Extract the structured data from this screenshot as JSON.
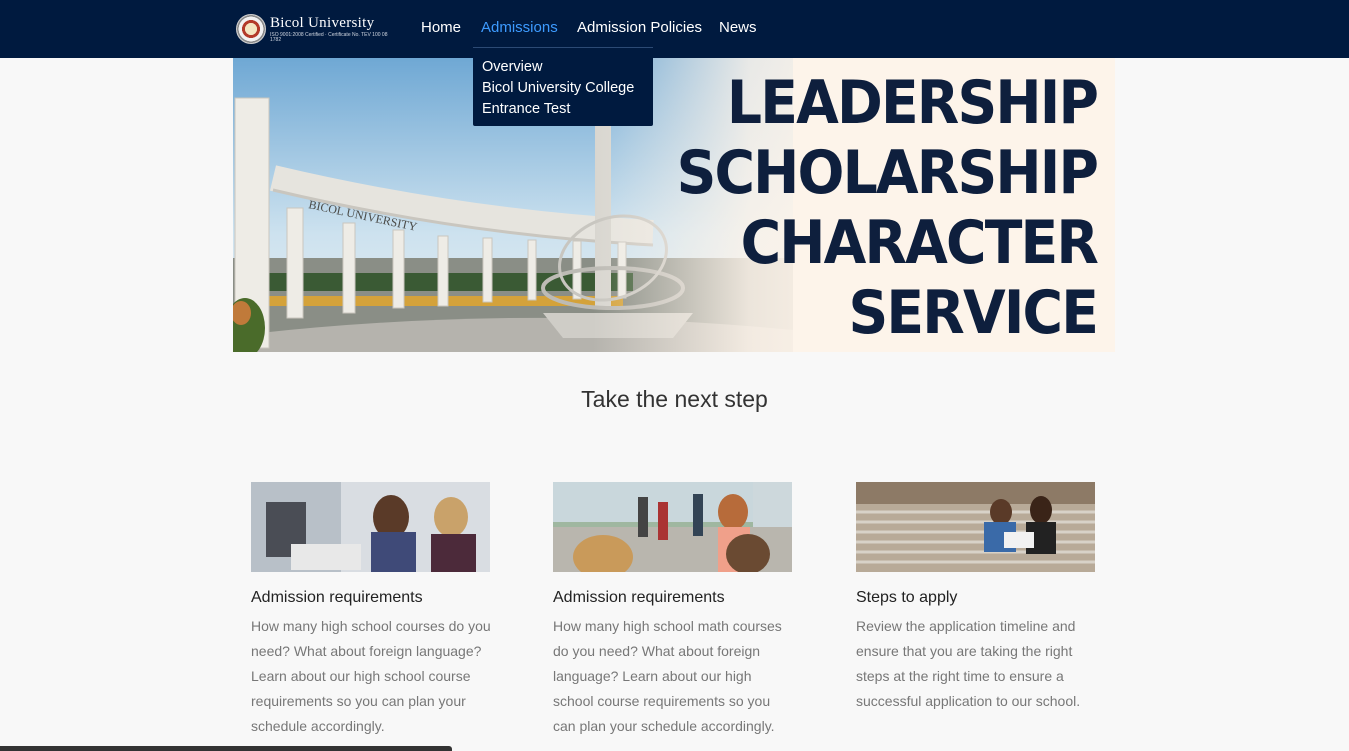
{
  "navbar": {
    "brand_name": "Bicol University",
    "brand_sub": "ISO 9001:2008 Certified · Certificate No. TEV 100 08 1782",
    "items": [
      {
        "label": "Home"
      },
      {
        "label": "Admissions"
      },
      {
        "label": "Admission Policies"
      },
      {
        "label": "News"
      }
    ],
    "active_index": 1
  },
  "dropdown": {
    "items": [
      {
        "label": "Overview"
      },
      {
        "label": "Bicol University College Entrance Test"
      }
    ]
  },
  "hero": {
    "words": [
      "LEADERSHIP",
      "SCHOLARSHIP",
      "CHARACTER",
      "SERVICE"
    ],
    "arch_text": "BICOL UNIVERSITY"
  },
  "section": {
    "title": "Take the next step"
  },
  "cards": [
    {
      "title": "Admission requirements",
      "text": "How many high school courses do you need? What about foreign language? Learn about our high school course requirements so you can plan your schedule accordingly."
    },
    {
      "title": "Admission requirements",
      "text": "How many high school math courses do you need? What about foreign language? Learn about our high school course requirements so you can plan your schedule accordingly."
    },
    {
      "title": "Steps to apply",
      "text": "Review the application timeline and ensure that you are taking the right steps at the right time to ensure a successful application to our school."
    }
  ],
  "colors": {
    "navbar_bg": "#001a3f",
    "active_link": "#3d9bff",
    "hero_text": "#0e1f3d"
  }
}
